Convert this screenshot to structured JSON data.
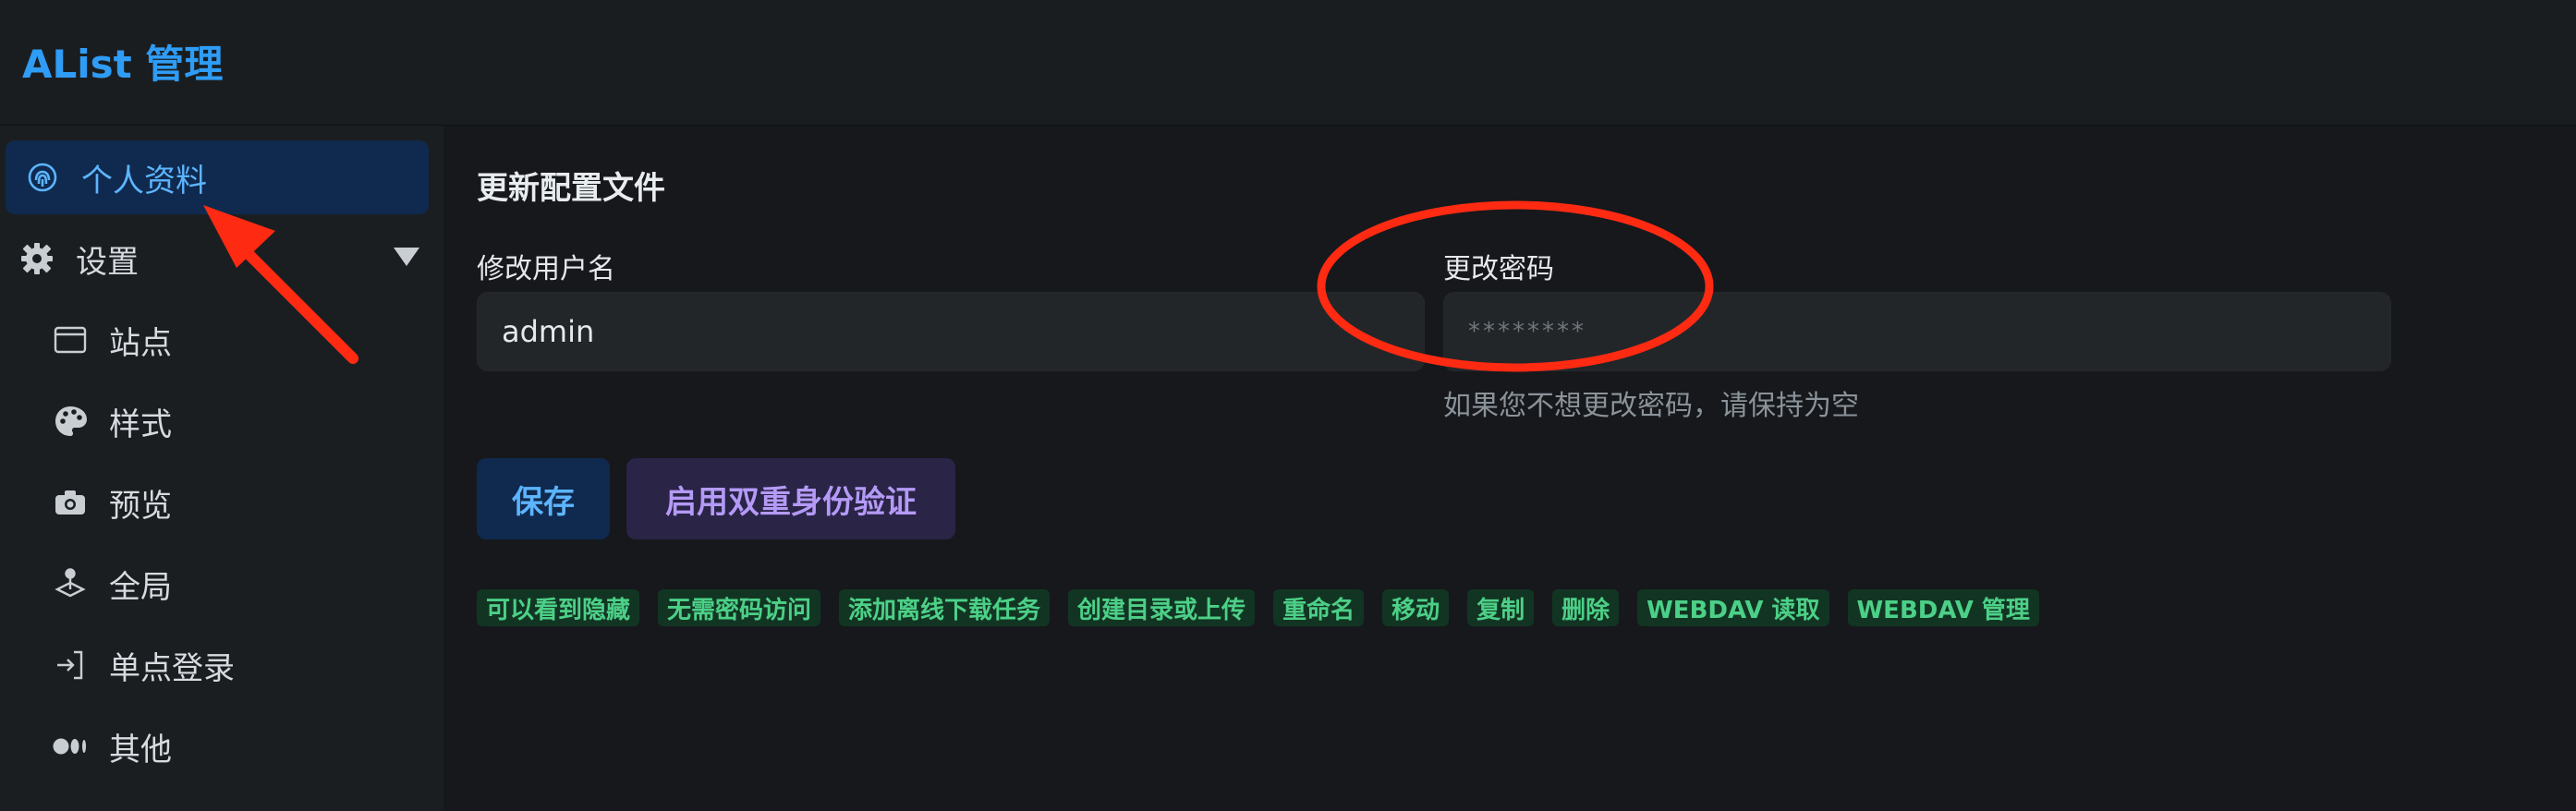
{
  "app": {
    "title": "AList 管理"
  },
  "sidebar": {
    "items": [
      {
        "label": "个人资料",
        "icon": "fingerprint-icon",
        "active": true
      },
      {
        "label": "设置",
        "icon": "gear-icon",
        "expandable": true
      },
      {
        "label": "站点",
        "icon": "window-icon"
      },
      {
        "label": "样式",
        "icon": "palette-icon"
      },
      {
        "label": "预览",
        "icon": "camera-icon"
      },
      {
        "label": "全局",
        "icon": "joystick-icon"
      },
      {
        "label": "单点登录",
        "icon": "login-icon"
      },
      {
        "label": "其他",
        "icon": "dots-icon"
      }
    ]
  },
  "profile": {
    "title": "更新配置文件",
    "username_label": "修改用户名",
    "username_value": "admin",
    "password_label": "更改密码",
    "password_placeholder": "********",
    "password_hint": "如果您不想更改密码，请保持为空",
    "save_label": "保存",
    "twofa_label": "启用双重身份验证"
  },
  "permissions": [
    "可以看到隐藏",
    "无需密码访问",
    "添加离线下载任务",
    "创建目录或上传",
    "重命名",
    "移动",
    "复制",
    "删除",
    "WEBDAV 读取",
    "WEBDAV 管理"
  ],
  "colors": {
    "accent": "#2f9cf5",
    "active_bg": "#0f2a4e",
    "tag_bg": "#123523",
    "tag_text": "#4cd087",
    "annotation": "#ff2a12"
  }
}
